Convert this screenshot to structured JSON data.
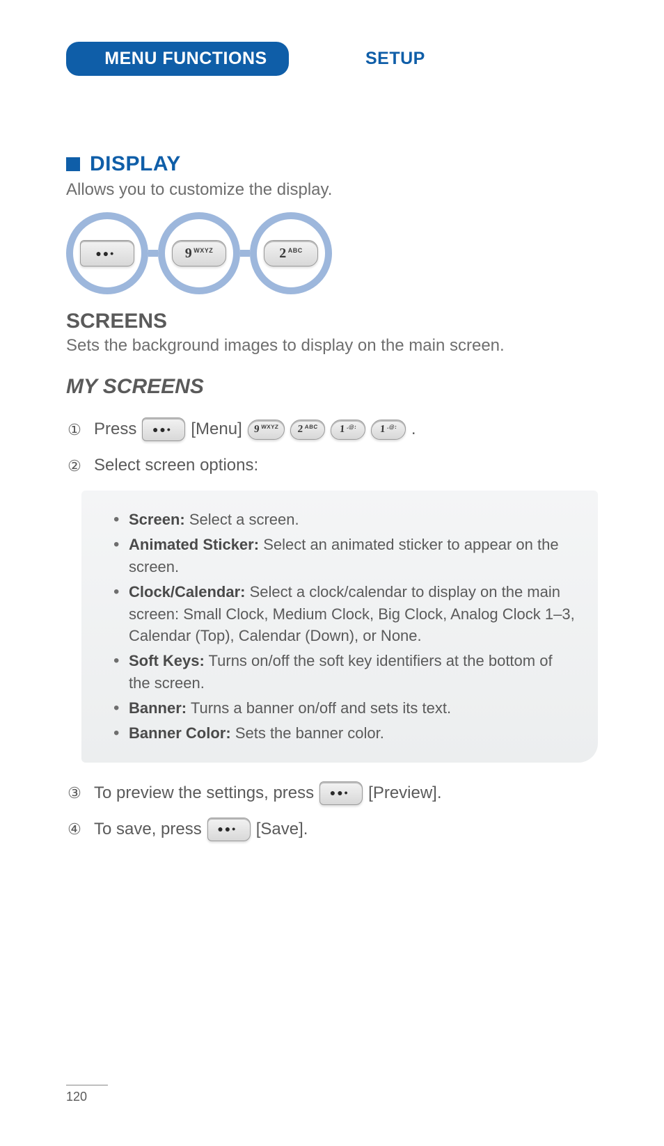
{
  "header": {
    "tab_label": "MENU FUNCTIONS",
    "right_label": "SETUP"
  },
  "display": {
    "title": "DISPLAY",
    "desc": "Allows you to customize the display."
  },
  "keypath": {
    "keys": [
      "menu-softkey",
      "9 WXYZ",
      "2 ABC"
    ]
  },
  "screens": {
    "title": "SCREENS",
    "desc": "Sets the background images to display on the main screen."
  },
  "my_screens": {
    "title": "MY SCREENS",
    "step1_prefix": "Press",
    "step1_menu": "[Menu]",
    "step1_keys": [
      "9 WXYZ",
      "2 ABC",
      "1 .@:",
      "1 .@:"
    ],
    "step1_suffix": ".",
    "step2": "Select screen options:",
    "options": [
      {
        "label": "Screen:",
        "text": "Select a screen."
      },
      {
        "label": "Animated Sticker:",
        "text": "Select an animated sticker to appear on the screen."
      },
      {
        "label": "Clock/Calendar:",
        "text": "Select a clock/calendar to display on the main screen: Small Clock, Medium Clock, Big Clock, Analog Clock 1–3, Calendar (Top), Calendar (Down), or None."
      },
      {
        "label": "Soft Keys:",
        "text": "Turns on/off the soft key identifiers at the bottom of the screen."
      },
      {
        "label": "Banner:",
        "text": "Turns a banner on/off and sets its text."
      },
      {
        "label": "Banner Color:",
        "text": "Sets the banner color."
      }
    ],
    "step3_prefix": "To preview the settings, press",
    "step3_suffix": "[Preview].",
    "step4_prefix": "To save, press",
    "step4_suffix": "[Save]."
  },
  "nums": {
    "n1": "①",
    "n2": "②",
    "n3": "③",
    "n4": "④"
  },
  "page_number": "120"
}
